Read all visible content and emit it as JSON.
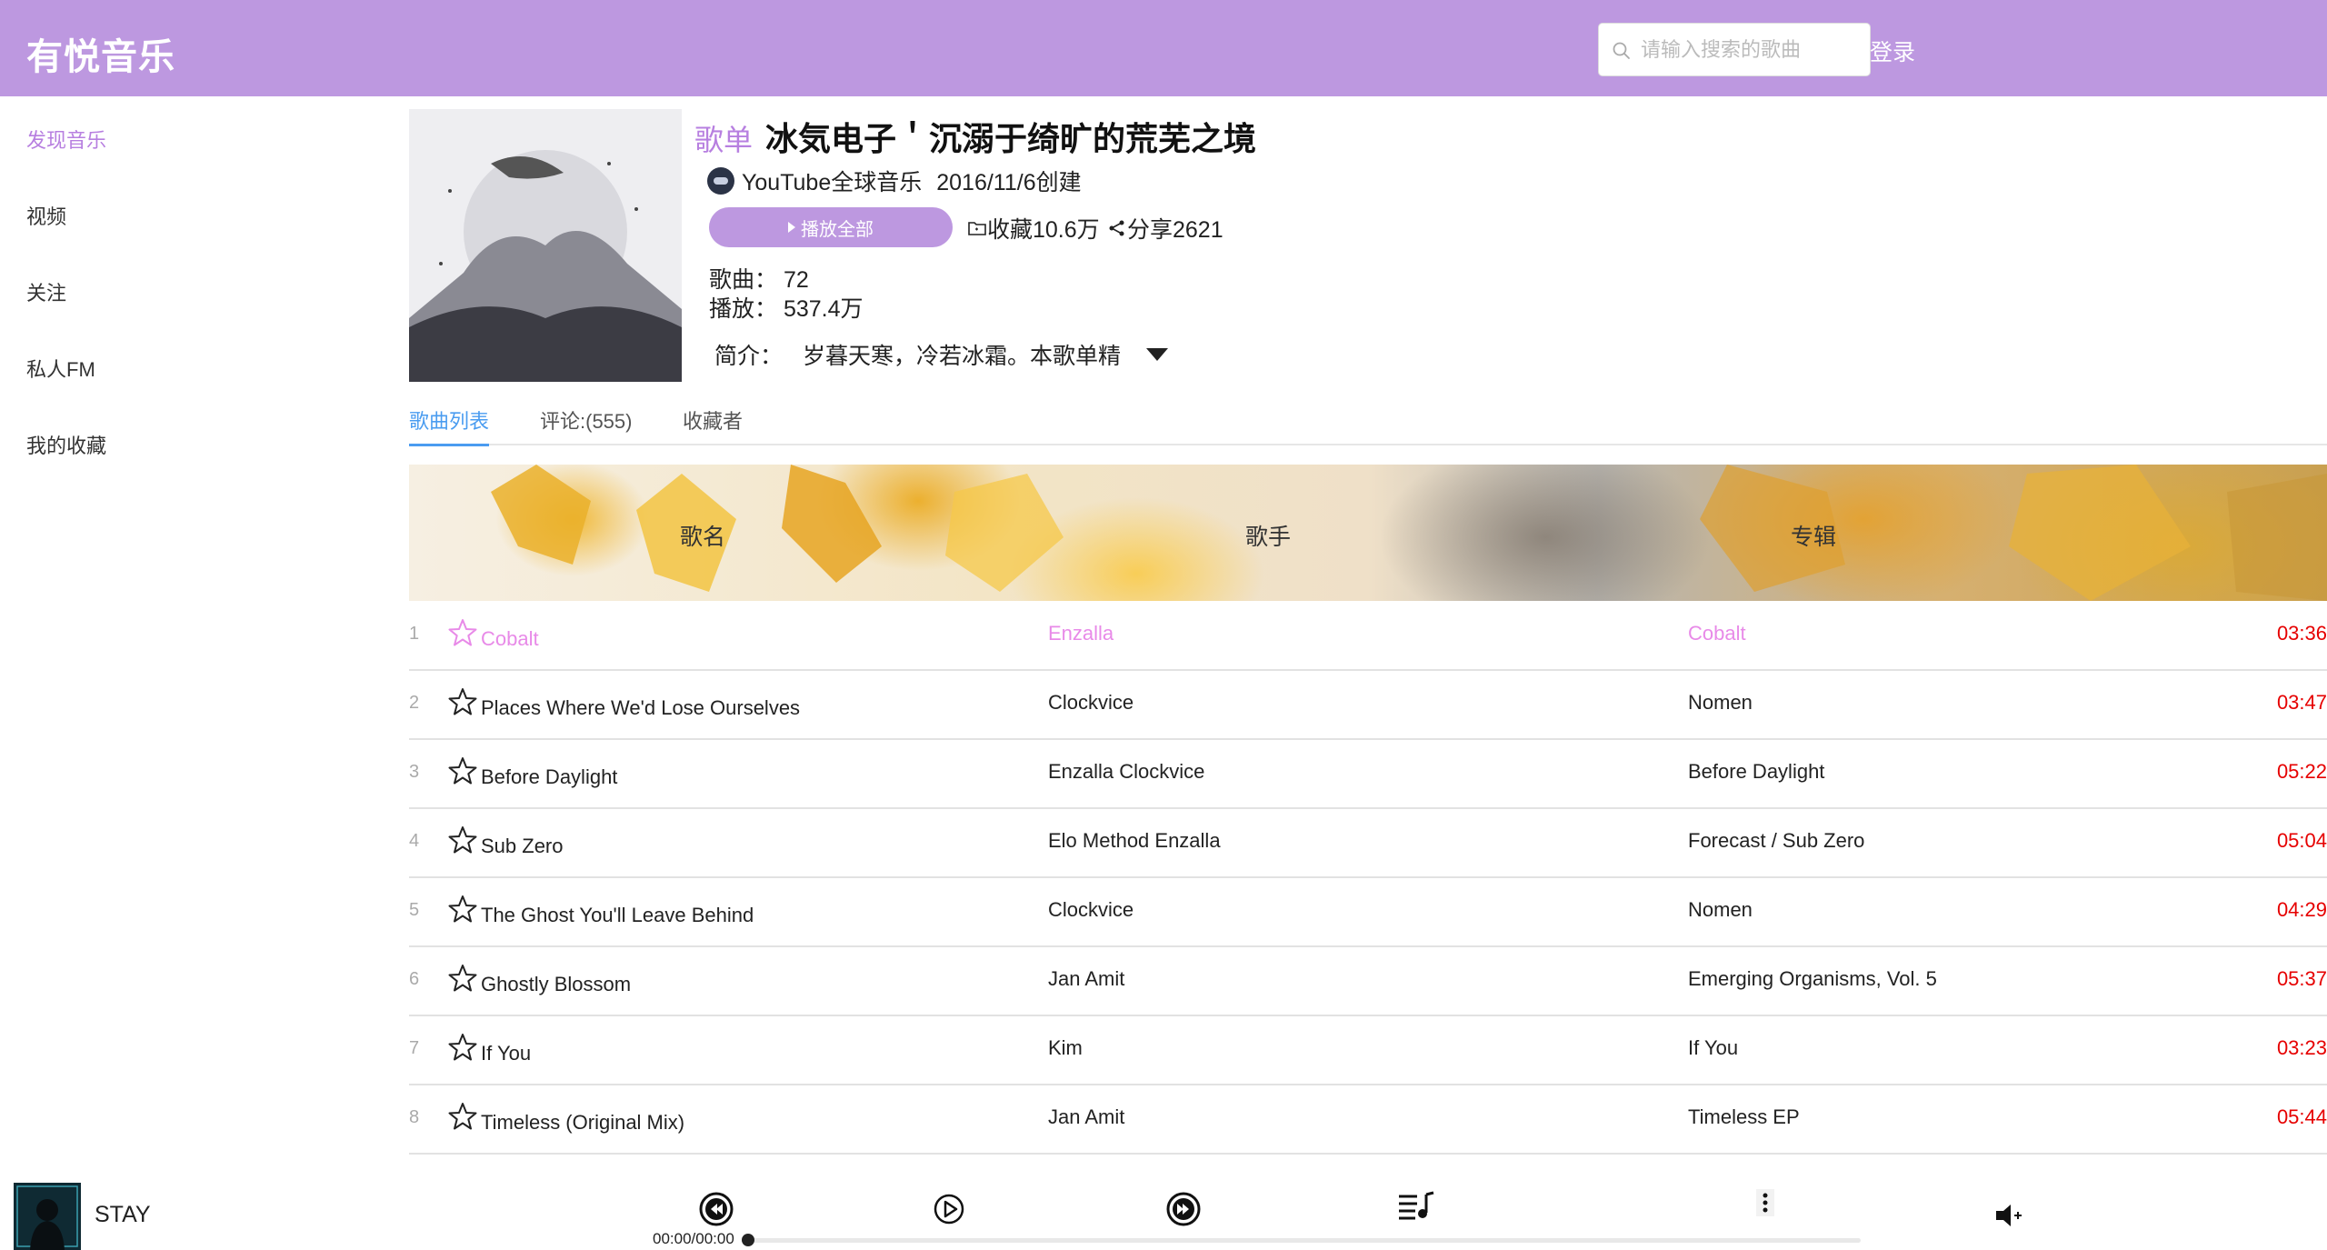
{
  "header": {
    "logo": "有悦音乐",
    "search_placeholder": "请输入搜索的歌曲",
    "login": "登录"
  },
  "sidebar": {
    "items": [
      {
        "label": "发现音乐",
        "active": true
      },
      {
        "label": "视频"
      },
      {
        "label": "关注"
      },
      {
        "label": "私人FM"
      },
      {
        "label": "我的收藏"
      }
    ]
  },
  "playlist": {
    "tag": "歌单",
    "title": "冰気电子＇沉溺于绮旷的荒芜之境",
    "creator": "YouTube全球音乐",
    "created": "2016/11/6创建",
    "play_all": "播放全部",
    "favorites": "收藏10.6万",
    "share": "分享2621",
    "songs_line": "歌曲：  72",
    "plays_line": "播放：  537.4万",
    "intro_label": "简介：",
    "intro_text": "岁暮天寒，冷若冰霜。本歌单精"
  },
  "tabs": [
    {
      "label": "歌曲列表",
      "active": true
    },
    {
      "label": "评论:(555)"
    },
    {
      "label": "收藏者"
    }
  ],
  "table": {
    "headers": {
      "name": "歌名",
      "singer": "歌手",
      "album": "专辑"
    },
    "rows": [
      {
        "index": "1",
        "name": "Cobalt",
        "singer": "Enzalla",
        "album": "Cobalt",
        "duration": "03:36",
        "playing": true
      },
      {
        "index": "2",
        "name": "Places Where We'd Lose Ourselves",
        "singer": "Clockvice",
        "album": "Nomen",
        "duration": "03:47"
      },
      {
        "index": "3",
        "name": "Before Daylight",
        "singer": "Enzalla   Clockvice",
        "album": "Before Daylight",
        "duration": "05:22"
      },
      {
        "index": "4",
        "name": "Sub Zero",
        "singer": "Elo Method   Enzalla",
        "album": "Forecast / Sub Zero",
        "duration": "05:04"
      },
      {
        "index": "5",
        "name": "The Ghost You'll Leave Behind",
        "singer": "Clockvice",
        "album": "Nomen",
        "duration": "04:29"
      },
      {
        "index": "6",
        "name": "Ghostly Blossom",
        "singer": "Jan Amit",
        "album": "Emerging Organisms, Vol. 5",
        "duration": "05:37"
      },
      {
        "index": "7",
        "name": "If You",
        "singer": "Kim",
        "album": "If You",
        "duration": "03:23"
      },
      {
        "index": "8",
        "name": "Timeless (Original Mix)",
        "singer": "Jan Amit",
        "album": "Timeless EP",
        "duration": "05:44"
      }
    ]
  },
  "player": {
    "song": "STAY",
    "time": "00:00/00:00",
    "progress": 0,
    "icons": [
      "prev-icon",
      "play-icon",
      "next-icon",
      "playlist-icon",
      "more-icon",
      "volume-icon"
    ]
  },
  "colors": {
    "brand": "#bd98e0",
    "active_text": "#b77fe0",
    "playing_row": "#e88ae8",
    "duration": "#e60000",
    "tab_active": "#4a9cf0"
  }
}
